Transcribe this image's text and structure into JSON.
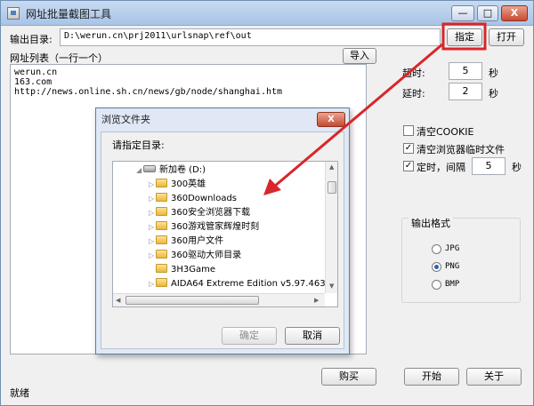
{
  "window": {
    "title": "网址批量截图工具",
    "minimize": "—",
    "maximize": "□",
    "close": "X"
  },
  "output": {
    "label": "输出目录:",
    "path": "D:\\werun.cn\\prj2011\\urlsnap\\ref\\out",
    "browse_label": "指定",
    "open_label": "打开"
  },
  "urls": {
    "label": "网址列表（一行一个）",
    "import_label": "导入",
    "lines": [
      "werun.cn",
      "163.com",
      "http://news.online.sh.cn/news/gb/node/shanghai.htm"
    ]
  },
  "options": {
    "timeout_label": "超时:",
    "timeout_value": "5",
    "timeout_unit": "秒",
    "delay_label": "延时:",
    "delay_value": "2",
    "delay_unit": "秒",
    "clear_cookie_label": "清空COOKIE",
    "clear_cookie_checked": false,
    "clear_temp_label": "清空浏览器临时文件",
    "clear_temp_checked": true,
    "timer_label": "定时，间隔",
    "timer_checked": true,
    "timer_value": "5",
    "timer_unit": "秒"
  },
  "format": {
    "title": "输出格式",
    "options": [
      "JPG",
      "PNG",
      "BMP"
    ],
    "selected": "PNG"
  },
  "dialog": {
    "title": "浏览文件夹",
    "close": "X",
    "prompt": "请指定目录:",
    "tree": [
      {
        "label": "新加卷 (D:)",
        "kind": "drive"
      },
      {
        "label": "300英雄",
        "kind": "folder"
      },
      {
        "label": "360Downloads",
        "kind": "folder"
      },
      {
        "label": "360安全浏览器下载",
        "kind": "folder"
      },
      {
        "label": "360游戏管家辉煌时刻",
        "kind": "folder"
      },
      {
        "label": "360用户文件",
        "kind": "folder"
      },
      {
        "label": "360驱动大师目录",
        "kind": "folder"
      },
      {
        "label": "3H3Game",
        "kind": "folder"
      },
      {
        "label": "AIDA64 Extreme Edition v5.97.463",
        "kind": "folder"
      }
    ],
    "ok_label": "确定",
    "cancel_label": "取消"
  },
  "footer": {
    "buy_label": "购买",
    "start_label": "开始",
    "about_label": "关于",
    "status": "就绪"
  },
  "colors": {
    "highlight": "#d9262a"
  }
}
